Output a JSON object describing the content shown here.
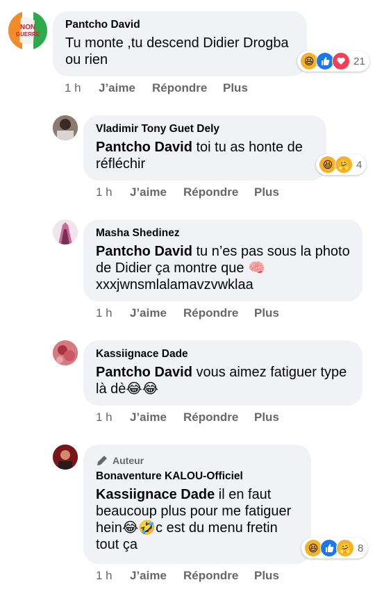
{
  "comments": [
    {
      "author": "Pantcho David",
      "text": "Tu monte ,tu descend Didier Drogba ou rien",
      "time": "1 h",
      "like": "J’aime",
      "reply": "Répondre",
      "more": "Plus",
      "reaction_count": "21",
      "avatar_text": "NON",
      "avatar_subtext": "GUERRE"
    },
    {
      "author": "Vladimir Tony Guet Dely",
      "mention": "Pantcho David",
      "text": " toi tu as honte de réfléchir",
      "time": "1 h",
      "like": "J’aime",
      "reply": "Répondre",
      "more": "Plus",
      "reaction_count": "4"
    },
    {
      "author": "Masha Shedinez",
      "mention": "Pantcho David",
      "text": " tu n’es pas sous la photo de Didier ça montre que 🧠 xxxjwnsmlalamavzvwklaa",
      "time": "1 h",
      "like": "J’aime",
      "reply": "Répondre",
      "more": "Plus"
    },
    {
      "author": "Kassiignace Dade",
      "mention": "Pantcho David",
      "text": " vous aimez fatiguer type là dè😂😂",
      "time": "1 h",
      "like": "J’aime",
      "reply": "Répondre",
      "more": "Plus"
    },
    {
      "badge": "Auteur",
      "author": "Bonaventure KALOU-Officiel",
      "mention": "Kassiignace Dade",
      "text": " il en faut beaucoup plus pour me fatiguer hein😂🤣c est du menu fretin tout ça",
      "time": "1 h",
      "like": "J’aime",
      "reply": "Répondre",
      "more": "Plus",
      "reaction_count": "8"
    }
  ],
  "colors": {
    "bubble": "#f0f2f5",
    "meta_text": "#65676b",
    "like_blue": "#1877f2",
    "love_red": "#f33e58",
    "haha_yellow": "#f7b125"
  }
}
